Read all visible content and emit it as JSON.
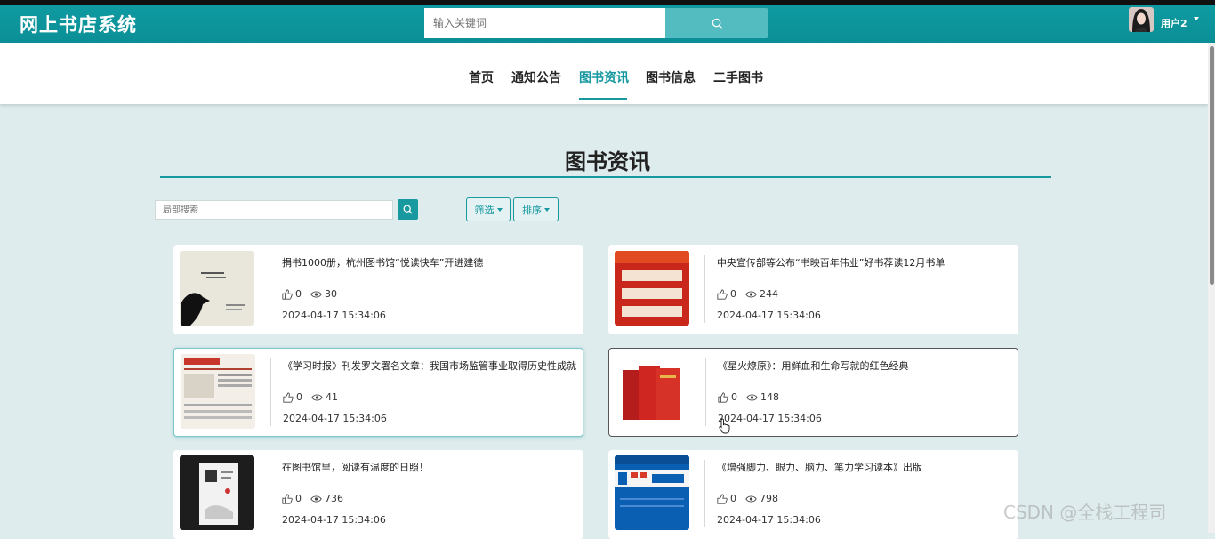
{
  "app": {
    "title": "网上书店系统"
  },
  "search": {
    "placeholder": "输入关键词"
  },
  "user": {
    "name": "用户2"
  },
  "nav": {
    "items": [
      "首页",
      "通知公告",
      "图书资讯",
      "图书信息",
      "二手图书"
    ],
    "active": "图书资讯"
  },
  "page": {
    "title": "图书资讯"
  },
  "filter": {
    "search_placeholder": "局部搜索",
    "filter_label": "筛选",
    "sort_label": "排序"
  },
  "articles": [
    {
      "title": "捐书1000册，杭州图书馆“悦读快车”开进建德",
      "likes": "0",
      "views": "30",
      "date": "2024-04-17 15:34:06"
    },
    {
      "title": "中央宣传部等公布“书映百年伟业”好书荐读12月书单",
      "likes": "0",
      "views": "244",
      "date": "2024-04-17 15:34:06"
    },
    {
      "title": "《学习时报》刊发罗文署名文章：我国市场监管事业取得历史性成就",
      "likes": "0",
      "views": "41",
      "date": "2024-04-17 15:34:06"
    },
    {
      "title": "《星火燎原》：用鲜血和生命写就的红色经典",
      "likes": "0",
      "views": "148",
      "date": "2024-04-17 15:34:06"
    },
    {
      "title": "在图书馆里，阅读有温度的日照！",
      "likes": "0",
      "views": "736",
      "date": "2024-04-17 15:34:06"
    },
    {
      "title": "《增强脚力、眼力、脑力、笔力学习读本》出版",
      "likes": "0",
      "views": "798",
      "date": "2024-04-17 15:34:06"
    }
  ],
  "watermark": "CSDN @全栈工程司",
  "colors": {
    "accent": "#17999f",
    "topbar": "#0f9aa1",
    "page_bg": "#deeced"
  }
}
